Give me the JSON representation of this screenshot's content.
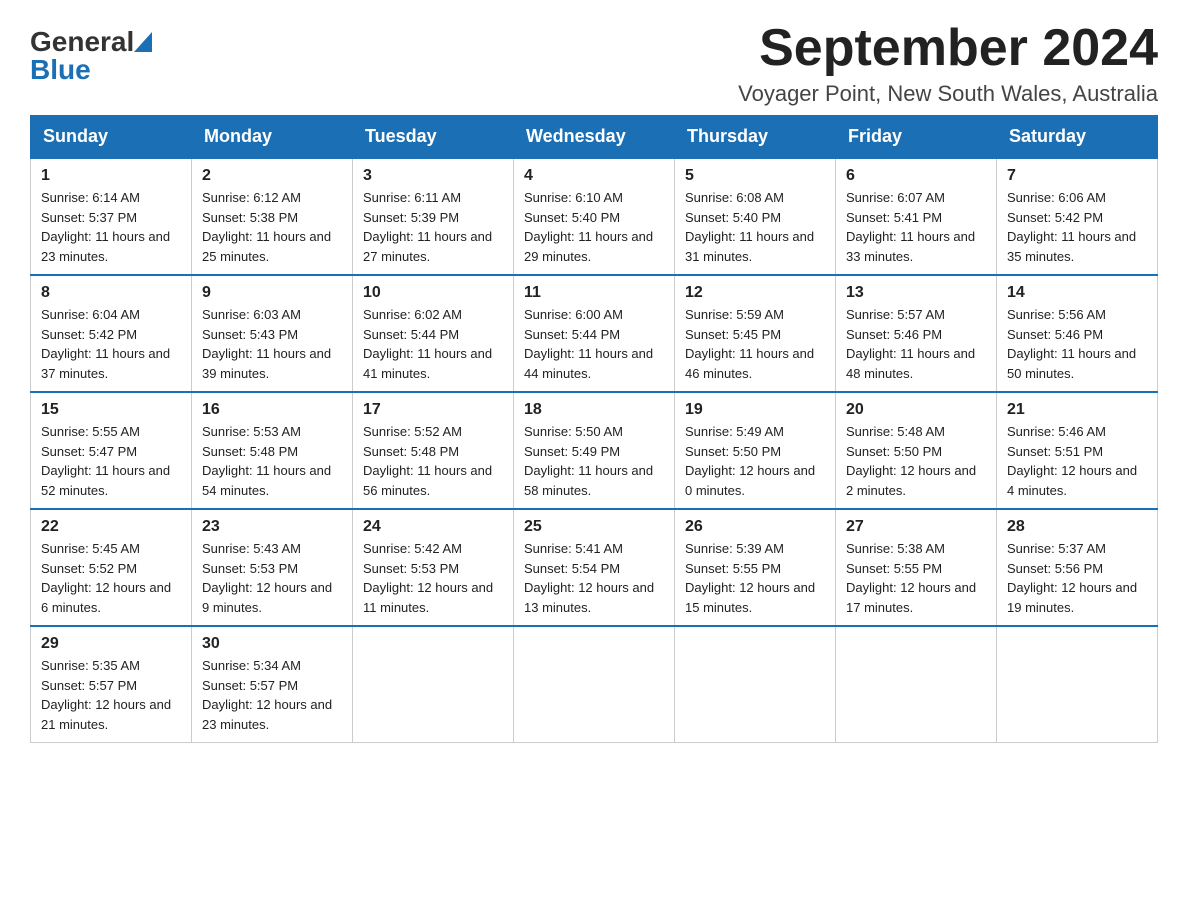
{
  "logo": {
    "general": "General",
    "blue": "Blue"
  },
  "title": "September 2024",
  "subtitle": "Voyager Point, New South Wales, Australia",
  "days_of_week": [
    "Sunday",
    "Monday",
    "Tuesday",
    "Wednesday",
    "Thursday",
    "Friday",
    "Saturday"
  ],
  "weeks": [
    [
      {
        "day": "1",
        "sunrise": "6:14 AM",
        "sunset": "5:37 PM",
        "daylight": "11 hours and 23 minutes."
      },
      {
        "day": "2",
        "sunrise": "6:12 AM",
        "sunset": "5:38 PM",
        "daylight": "11 hours and 25 minutes."
      },
      {
        "day": "3",
        "sunrise": "6:11 AM",
        "sunset": "5:39 PM",
        "daylight": "11 hours and 27 minutes."
      },
      {
        "day": "4",
        "sunrise": "6:10 AM",
        "sunset": "5:40 PM",
        "daylight": "11 hours and 29 minutes."
      },
      {
        "day": "5",
        "sunrise": "6:08 AM",
        "sunset": "5:40 PM",
        "daylight": "11 hours and 31 minutes."
      },
      {
        "day": "6",
        "sunrise": "6:07 AM",
        "sunset": "5:41 PM",
        "daylight": "11 hours and 33 minutes."
      },
      {
        "day": "7",
        "sunrise": "6:06 AM",
        "sunset": "5:42 PM",
        "daylight": "11 hours and 35 minutes."
      }
    ],
    [
      {
        "day": "8",
        "sunrise": "6:04 AM",
        "sunset": "5:42 PM",
        "daylight": "11 hours and 37 minutes."
      },
      {
        "day": "9",
        "sunrise": "6:03 AM",
        "sunset": "5:43 PM",
        "daylight": "11 hours and 39 minutes."
      },
      {
        "day": "10",
        "sunrise": "6:02 AM",
        "sunset": "5:44 PM",
        "daylight": "11 hours and 41 minutes."
      },
      {
        "day": "11",
        "sunrise": "6:00 AM",
        "sunset": "5:44 PM",
        "daylight": "11 hours and 44 minutes."
      },
      {
        "day": "12",
        "sunrise": "5:59 AM",
        "sunset": "5:45 PM",
        "daylight": "11 hours and 46 minutes."
      },
      {
        "day": "13",
        "sunrise": "5:57 AM",
        "sunset": "5:46 PM",
        "daylight": "11 hours and 48 minutes."
      },
      {
        "day": "14",
        "sunrise": "5:56 AM",
        "sunset": "5:46 PM",
        "daylight": "11 hours and 50 minutes."
      }
    ],
    [
      {
        "day": "15",
        "sunrise": "5:55 AM",
        "sunset": "5:47 PM",
        "daylight": "11 hours and 52 minutes."
      },
      {
        "day": "16",
        "sunrise": "5:53 AM",
        "sunset": "5:48 PM",
        "daylight": "11 hours and 54 minutes."
      },
      {
        "day": "17",
        "sunrise": "5:52 AM",
        "sunset": "5:48 PM",
        "daylight": "11 hours and 56 minutes."
      },
      {
        "day": "18",
        "sunrise": "5:50 AM",
        "sunset": "5:49 PM",
        "daylight": "11 hours and 58 minutes."
      },
      {
        "day": "19",
        "sunrise": "5:49 AM",
        "sunset": "5:50 PM",
        "daylight": "12 hours and 0 minutes."
      },
      {
        "day": "20",
        "sunrise": "5:48 AM",
        "sunset": "5:50 PM",
        "daylight": "12 hours and 2 minutes."
      },
      {
        "day": "21",
        "sunrise": "5:46 AM",
        "sunset": "5:51 PM",
        "daylight": "12 hours and 4 minutes."
      }
    ],
    [
      {
        "day": "22",
        "sunrise": "5:45 AM",
        "sunset": "5:52 PM",
        "daylight": "12 hours and 6 minutes."
      },
      {
        "day": "23",
        "sunrise": "5:43 AM",
        "sunset": "5:53 PM",
        "daylight": "12 hours and 9 minutes."
      },
      {
        "day": "24",
        "sunrise": "5:42 AM",
        "sunset": "5:53 PM",
        "daylight": "12 hours and 11 minutes."
      },
      {
        "day": "25",
        "sunrise": "5:41 AM",
        "sunset": "5:54 PM",
        "daylight": "12 hours and 13 minutes."
      },
      {
        "day": "26",
        "sunrise": "5:39 AM",
        "sunset": "5:55 PM",
        "daylight": "12 hours and 15 minutes."
      },
      {
        "day": "27",
        "sunrise": "5:38 AM",
        "sunset": "5:55 PM",
        "daylight": "12 hours and 17 minutes."
      },
      {
        "day": "28",
        "sunrise": "5:37 AM",
        "sunset": "5:56 PM",
        "daylight": "12 hours and 19 minutes."
      }
    ],
    [
      {
        "day": "29",
        "sunrise": "5:35 AM",
        "sunset": "5:57 PM",
        "daylight": "12 hours and 21 minutes."
      },
      {
        "day": "30",
        "sunrise": "5:34 AM",
        "sunset": "5:57 PM",
        "daylight": "12 hours and 23 minutes."
      },
      null,
      null,
      null,
      null,
      null
    ]
  ],
  "labels": {
    "sunrise_prefix": "Sunrise: ",
    "sunset_prefix": "Sunset: ",
    "daylight_prefix": "Daylight: "
  }
}
